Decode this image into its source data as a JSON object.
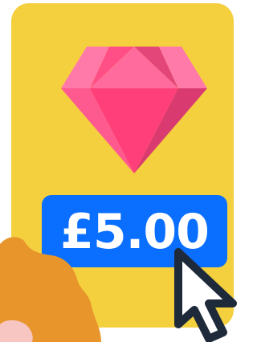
{
  "card": {
    "background_color": "#f4d03f"
  },
  "gem": {
    "icon": "diamond-icon",
    "colors": {
      "light": "#ff7aa8",
      "mid": "#ff4f86",
      "dark": "#d93b70"
    }
  },
  "price": {
    "label": "£5.00",
    "badge_color": "#0a6fff",
    "text_color": "#ffffff"
  },
  "cursor": {
    "icon": "mouse-pointer-icon",
    "fill": "#ffffff",
    "stroke": "#1e2a3a"
  },
  "character": {
    "hair_color": "#e8952b",
    "skin_color": "#f7c6c2"
  }
}
